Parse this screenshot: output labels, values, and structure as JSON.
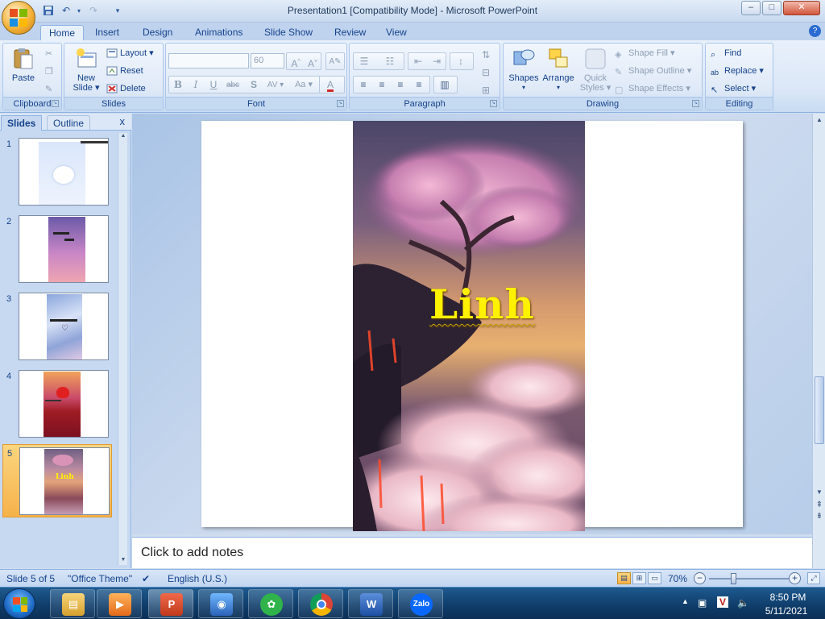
{
  "window": {
    "title": "Presentation1 [Compatibility Mode] - Microsoft PowerPoint",
    "minimize": "–",
    "maximize": "□",
    "close": "✕"
  },
  "ribbon_tabs": [
    "Home",
    "Insert",
    "Design",
    "Animations",
    "Slide Show",
    "Review",
    "View"
  ],
  "active_tab": "Home",
  "clipboard": {
    "paste": "Paste",
    "label": "Clipboard"
  },
  "slides_group": {
    "new_slide_1": "New",
    "new_slide_2": "Slide ▾",
    "layout": "Layout ▾",
    "reset": "Reset",
    "delete": "Delete",
    "label": "Slides"
  },
  "font": {
    "font_name": "",
    "font_size": "60",
    "label": "Font",
    "bold": "B",
    "italic": "I",
    "underline": "U",
    "strike": "abc",
    "shadow": "S",
    "spacing": "AV ▾",
    "case": "Aa ▾",
    "color": "A",
    "grow": "A^",
    "shrink": "A˅",
    "clear": "A"
  },
  "paragraph": {
    "label": "Paragraph"
  },
  "drawing": {
    "shapes": "Shapes",
    "arrange": "Arrange",
    "quick_styles_1": "Quick",
    "quick_styles_2": "Styles ▾",
    "shape_fill": "Shape Fill ▾",
    "shape_outline": "Shape Outline ▾",
    "shape_effects": "Shape Effects ▾",
    "label": "Drawing"
  },
  "editing": {
    "find": "Find",
    "replace": "Replace ▾",
    "select": "Select ▾",
    "label": "Editing"
  },
  "left_panel": {
    "tab_slides": "Slides",
    "tab_outline": "Outline",
    "close": "x",
    "thumbnails": [
      {
        "num": "1",
        "caption": ""
      },
      {
        "num": "2",
        "caption": ""
      },
      {
        "num": "3",
        "caption": ""
      },
      {
        "num": "4",
        "caption": ""
      },
      {
        "num": "5",
        "caption": "Linh"
      }
    ],
    "selected": 5
  },
  "slide": {
    "title": "Linh"
  },
  "notes": {
    "placeholder": "Click to add notes"
  },
  "status": {
    "slide_pos": "Slide 5 of 5",
    "theme": "\"Office Theme\"",
    "language": "English (U.S.)",
    "zoom": "70%",
    "zoom_level": 0.7
  },
  "taskbar": {
    "time": "8:50 PM",
    "date": "5/11/2021",
    "apps": [
      "explorer",
      "media-player",
      "powerpoint",
      "photos",
      "coc-coc",
      "chrome",
      "word",
      "zalo"
    ],
    "zalo_label": "Zalo"
  },
  "colors": {
    "accent": "#15428b",
    "title_text": "#fff200",
    "selected_thumb": "#f6b24a"
  }
}
